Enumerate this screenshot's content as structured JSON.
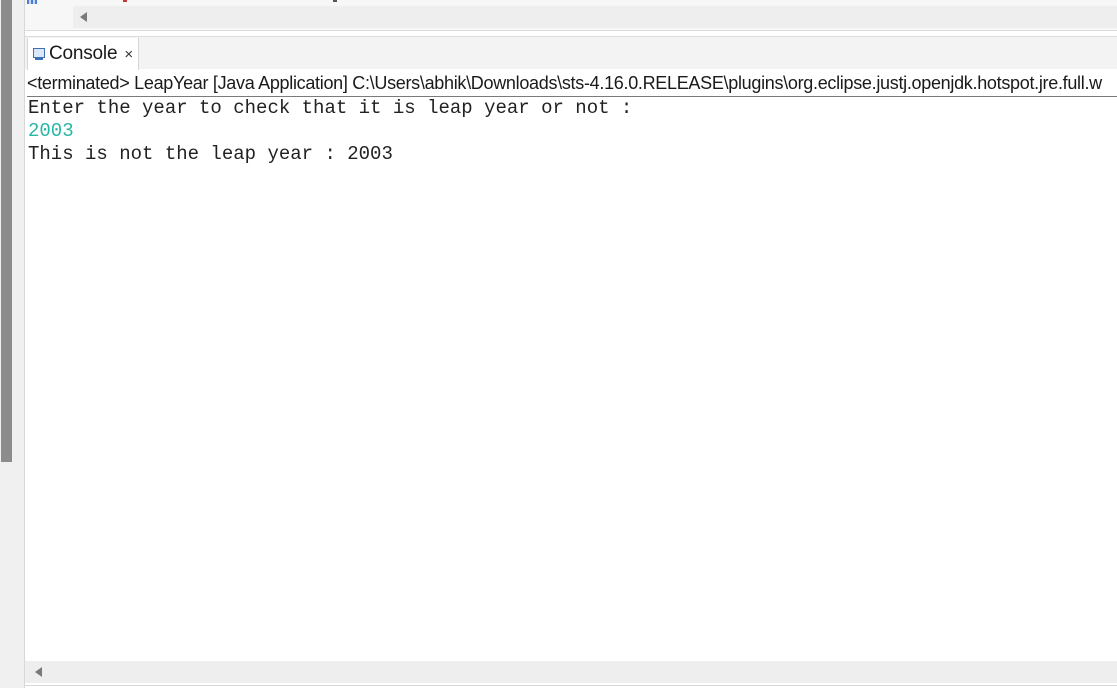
{
  "console": {
    "tab_label": "Console",
    "tab_close": "×",
    "status": "<terminated> LeapYear [Java Application] C:\\Users\\abhik\\Downloads\\sts-4.16.0.RELEASE\\plugins\\org.eclipse.justj.openjdk.hotspot.jre.full.w",
    "output": {
      "line1": "Enter the year to check that it is leap year or not :",
      "line2": "2003",
      "line3": "This is not the leap year : 2003"
    }
  },
  "icons": {
    "tab_icon": "console-icon",
    "scroll_left": "scroll-left-arrow-icon"
  },
  "colors": {
    "user_input": "#27b7a5",
    "scrollbar_thumb": "#8c8c8c"
  }
}
